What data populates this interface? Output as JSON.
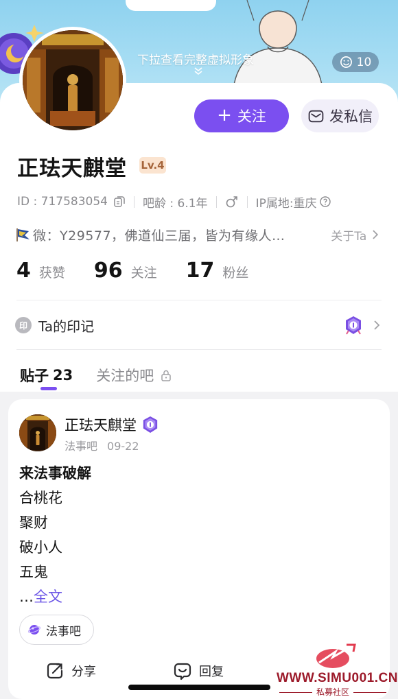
{
  "banner": {
    "pull_hint": "下拉查看完整虚拟形象",
    "visitor_count": "10"
  },
  "profile": {
    "username": "正珐天麒堂",
    "level": "Lv.4",
    "id_text": "ID : 717583054",
    "bar_age": "吧龄 : 6.1年",
    "gender": "male",
    "ip_location": "IP属地:重庆",
    "bio": "微：Y29577，佛道仙三届，皆为有缘人…",
    "about_label": "关于Ta"
  },
  "actions": {
    "follow_label": "关注",
    "message_label": "发私信"
  },
  "stats": [
    {
      "value": "4",
      "label": "获赞"
    },
    {
      "value": "96",
      "label": "关注"
    },
    {
      "value": "17",
      "label": "粉丝"
    }
  ],
  "imprint": {
    "icon_text": "印",
    "label": "Ta的印记"
  },
  "tabs": {
    "posts_label": "贴子",
    "posts_count": "23",
    "followed_bars_label": "关注的吧"
  },
  "post": {
    "author": "正珐天麒堂",
    "forum": "法事吧",
    "date": "09-22",
    "title": "来法事破解",
    "lines": [
      "合桃花",
      "聚财",
      "破小人",
      "五鬼"
    ],
    "more_prefix": "…",
    "more_link": "全文",
    "forum_tag": "法事吧",
    "share_label": "分享",
    "reply_label": "回复"
  },
  "watermark": {
    "url": "WWW.SIMU001.CN",
    "subtitle": "私募社区"
  },
  "colors": {
    "accent": "#7b4ff0",
    "banner": "#a4dcf3",
    "level_bg": "#fbe4d0",
    "watermark": "#9c1a2a"
  }
}
